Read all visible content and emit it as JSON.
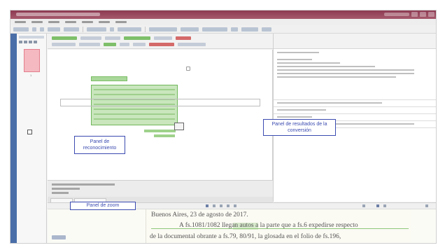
{
  "annotations": {
    "recognition_panel": "Panel de reconocimiento",
    "results_panel": "Panel de resultados de la conversión",
    "zoom_panel": "Panel de zoom"
  },
  "thumbnails": {
    "page_number": "1"
  },
  "zoom": {
    "line1": "Buenos Aires, 23 de agosto de 2017.",
    "line2": "A fs.1081/1082 llegan autos a la parte que a fs.6 expedirse respecto",
    "line3": "de la documental obrante a fs.79, 80/91, la glosada en el folio de fs.196,"
  },
  "colors": {
    "titlebar": "#8d3a52",
    "callout_border": "#3b4bb0",
    "recognized_text_area": "#c9e6bd",
    "page_thumbnail": "#f5b9c1"
  }
}
